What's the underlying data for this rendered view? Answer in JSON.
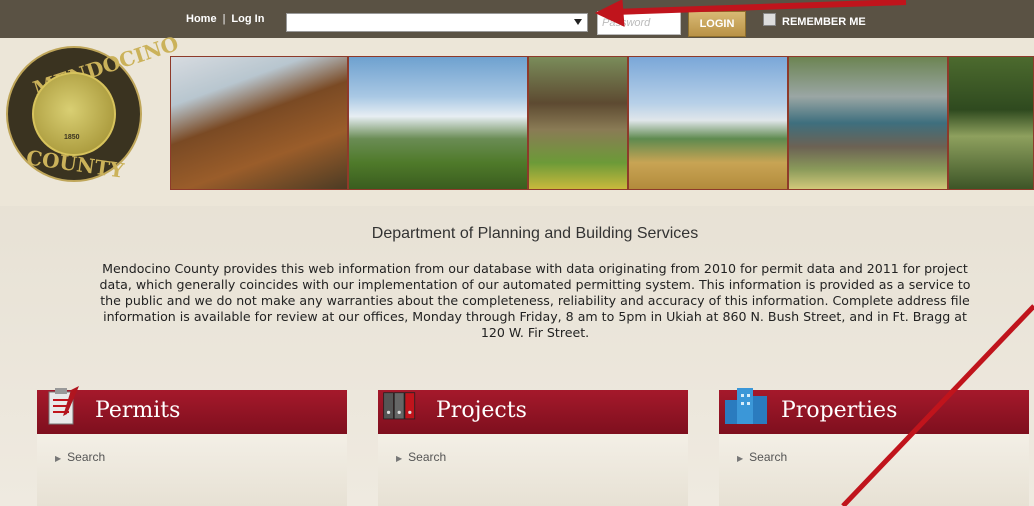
{
  "topbar": {
    "home_label": "Home",
    "separator": "|",
    "login_link_label": "Log In",
    "password_placeholder": "Password",
    "login_button": "LOGIN",
    "remember_label": "REMEMBER ME"
  },
  "header": {
    "seal_top_text": "MENDOCINO",
    "seal_bottom_text": "COUNTY",
    "seal_year": "1850"
  },
  "main": {
    "department_title": "Department of Planning and Building Services",
    "description": "Mendocino County provides this web information from our database with data originating from 2010 for permit data and 2011 for project data, which generally coincides with our implementation of our automated permitting system.  This information is provided as a service to the public and we do not make any warranties about the completeness, reliability and accuracy of this information. Complete address file information is available for review at our offices, Monday through Friday, 8 am to 5pm in Ukiah at 860 N. Bush Street, and in Ft. Bragg at 120 W. Fir Street."
  },
  "panels": [
    {
      "title": "Permits",
      "link": "Search",
      "icon": "clipboard-icon"
    },
    {
      "title": "Projects",
      "link": "Search",
      "icon": "binders-icon"
    },
    {
      "title": "Properties",
      "link": "Search",
      "icon": "buildings-icon"
    }
  ],
  "annotation_color": "#c0141c"
}
